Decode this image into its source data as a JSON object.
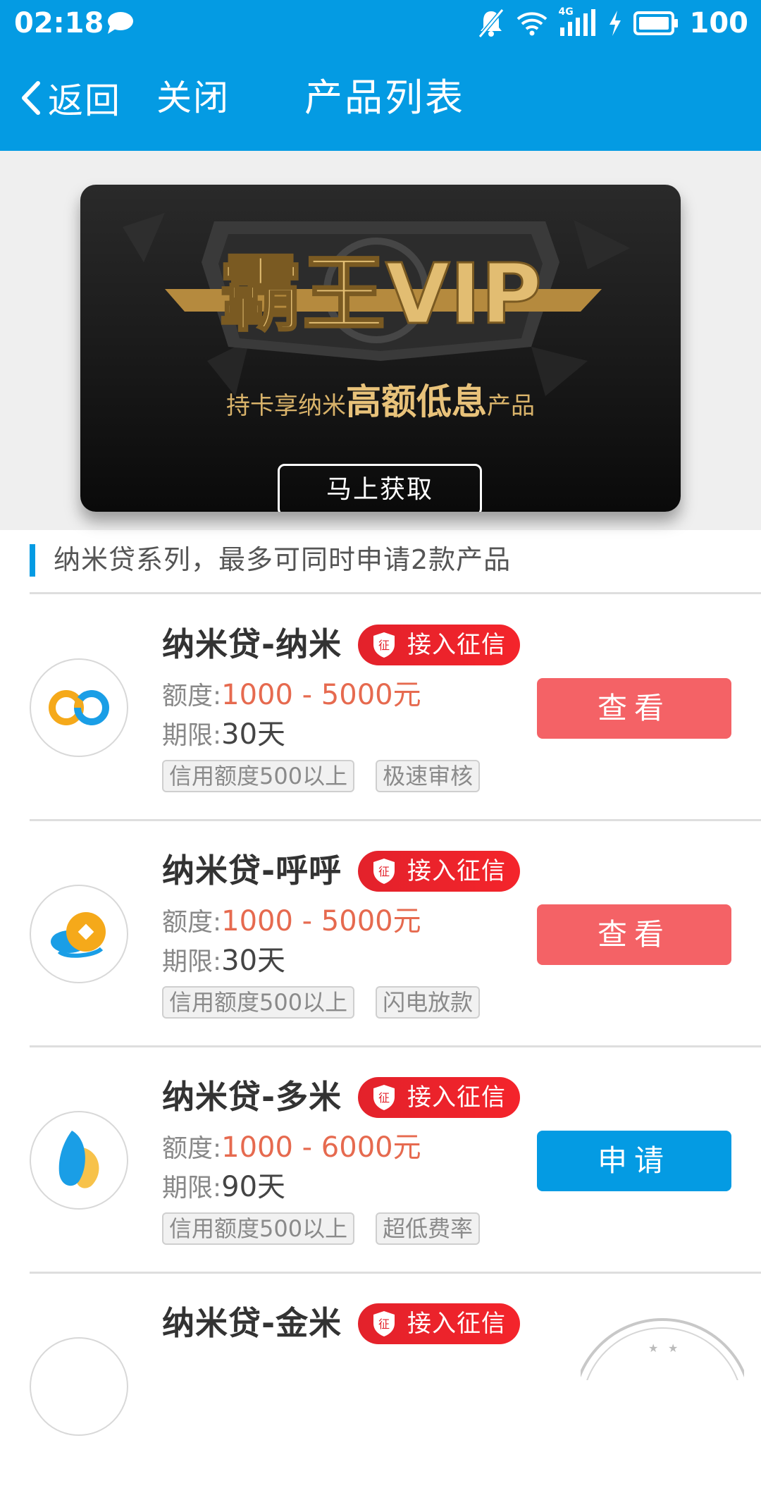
{
  "status_bar": {
    "time": "02:18",
    "network": "4G",
    "battery": "100"
  },
  "nav": {
    "back_label": "返回",
    "close_label": "关闭",
    "title": "产品列表"
  },
  "banner": {
    "logo_text": "霸王VIP",
    "subtitle_pre": "持卡享纳米",
    "subtitle_highlight": "高额低息",
    "subtitle_post": "产品",
    "button_label": "马上获取"
  },
  "section": {
    "title": "纳米贷系列，最多可同时申请2款产品"
  },
  "products": [
    {
      "name": "纳米贷-纳米",
      "badge": "接入征信",
      "badge_icon": "征",
      "amount_label": "额度:",
      "amount": "1000 - 5000元",
      "term_label": "期限:",
      "term": "30天",
      "tags": [
        "信用额度500以上",
        "极速审核"
      ],
      "action": "查看",
      "action_type": "view",
      "logo": "infinity-icon"
    },
    {
      "name": "纳米贷-呼呼",
      "badge": "接入征信",
      "badge_icon": "征",
      "amount_label": "额度:",
      "amount": "1000 - 5000元",
      "term_label": "期限:",
      "term": "30天",
      "tags": [
        "信用额度500以上",
        "闪电放款"
      ],
      "action": "查看",
      "action_type": "view",
      "logo": "coin-icon"
    },
    {
      "name": "纳米贷-多米",
      "badge": "接入征信",
      "badge_icon": "征",
      "amount_label": "额度:",
      "amount": "1000 - 6000元",
      "term_label": "期限:",
      "term": "90天",
      "tags": [
        "信用额度500以上",
        "超低费率"
      ],
      "action": "申请",
      "action_type": "apply",
      "logo": "leaf-icon"
    },
    {
      "name": "纳米贷-金米",
      "badge": "接入征信",
      "badge_icon": "征"
    }
  ],
  "colors": {
    "primary": "#049be3",
    "view_button": "#f46266",
    "amount": "#e66a4f",
    "badge": "#ec2329",
    "gold": "#d9b36a"
  }
}
